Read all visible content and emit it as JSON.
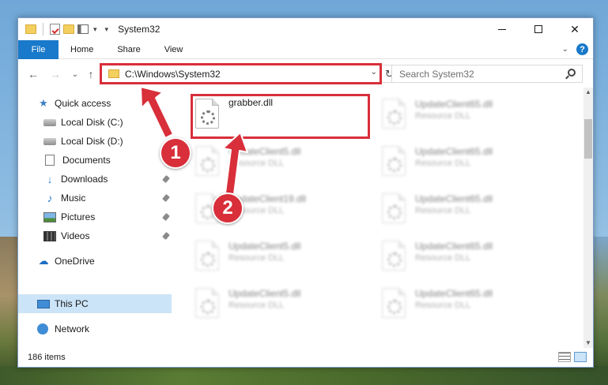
{
  "window": {
    "title": "System32"
  },
  "ribbon": {
    "tabs": [
      "File",
      "Home",
      "Share",
      "View"
    ],
    "help": "?"
  },
  "nav": {
    "address": "C:\\Windows\\System32",
    "search_placeholder": "Search System32"
  },
  "sidebar": {
    "items": [
      {
        "label": "Quick access"
      },
      {
        "label": "Local Disk (C:)"
      },
      {
        "label": "Local Disk (D:)"
      },
      {
        "label": "Documents"
      },
      {
        "label": "Downloads"
      },
      {
        "label": "Music"
      },
      {
        "label": "Pictures"
      },
      {
        "label": "Videos"
      },
      {
        "label": "OneDrive"
      },
      {
        "label": "This PC"
      },
      {
        "label": "Network"
      }
    ]
  },
  "files": {
    "highlighted": {
      "name": "grabber.dll"
    },
    "items": [
      {
        "name": "UpdateClient65.dll",
        "type": "Resource DLL"
      },
      {
        "name": "UpdateClient5.dll",
        "type": "Resource DLL"
      },
      {
        "name": "UpdateClient65.dll",
        "type": "Resource DLL"
      },
      {
        "name": "UpdateClient19.dll",
        "type": "Resource DLL"
      },
      {
        "name": "UpdateClient65.dll",
        "type": "Resource DLL"
      },
      {
        "name": "UpdateClient5.dll",
        "type": "Resource DLL"
      },
      {
        "name": "UpdateClient65.dll",
        "type": "Resource DLL"
      },
      {
        "name": "UpdateClient5.dll",
        "type": "Resource DLL"
      },
      {
        "name": "UpdateClient65.dll",
        "type": "Resource DLL"
      }
    ]
  },
  "status": {
    "item_count": "186 items"
  },
  "callouts": {
    "step1": "1",
    "step2": "2"
  },
  "colors": {
    "accent": "#1979ca",
    "highlight": "#d82f3a",
    "selection": "#cce4f7"
  }
}
